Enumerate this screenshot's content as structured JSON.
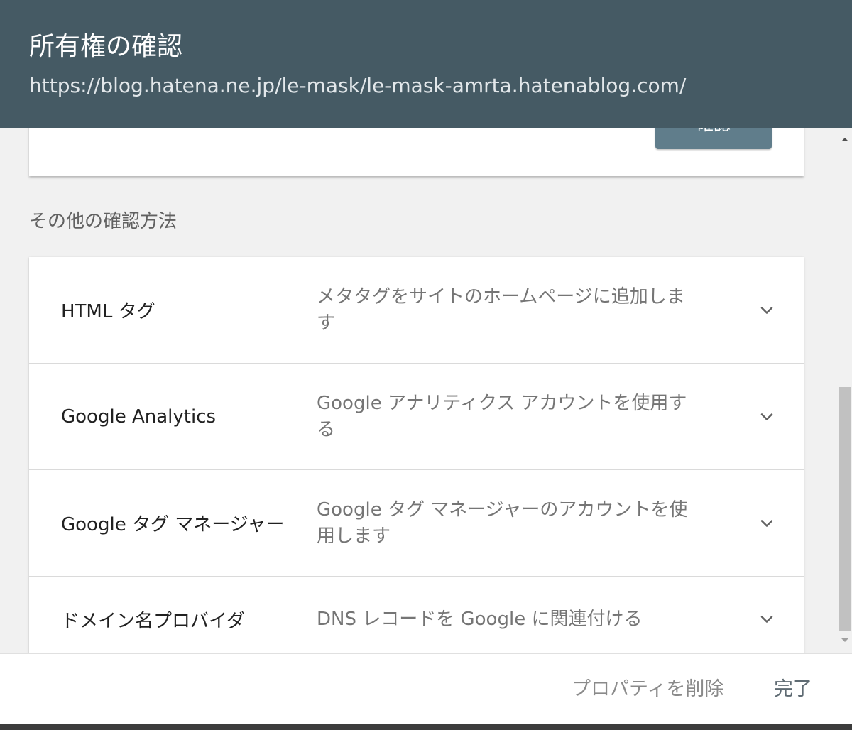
{
  "dialog": {
    "title": "所有権の確認",
    "url": "https://blog.hatena.ne.jp/le-mask/le-mask-amrta.hatenablog.com/"
  },
  "previous_card": {
    "confirm_label": "確認"
  },
  "other_methods": {
    "heading": "その他の確認方法",
    "items": [
      {
        "name": "HTML タグ",
        "desc_line1": "メタタグをサイトのホームページに追加しま",
        "desc_line2": "す",
        "icon": "chevron-down-icon"
      },
      {
        "name": "Google Analytics",
        "desc_line1": "Google アナリティクス アカウントを使用す",
        "desc_line2": "る",
        "icon": "chevron-down-icon"
      },
      {
        "name": "Google タグ マネージャー",
        "desc_line1": "Google タグ マネージャーのアカウントを使",
        "desc_line2": "用します",
        "icon": "chevron-down-icon"
      },
      {
        "name": "ドメイン名プロバイダ",
        "desc_line1": "DNS レコードを Google に関連付ける",
        "desc_line2": "",
        "icon": "chevron-down-icon"
      }
    ]
  },
  "footer": {
    "delete_label": "プロパティを削除",
    "done_label": "完了"
  },
  "colors": {
    "header_bg": "#455a64",
    "confirm_button_bg": "#607d8b",
    "page_bg": "#f1f1f1"
  }
}
